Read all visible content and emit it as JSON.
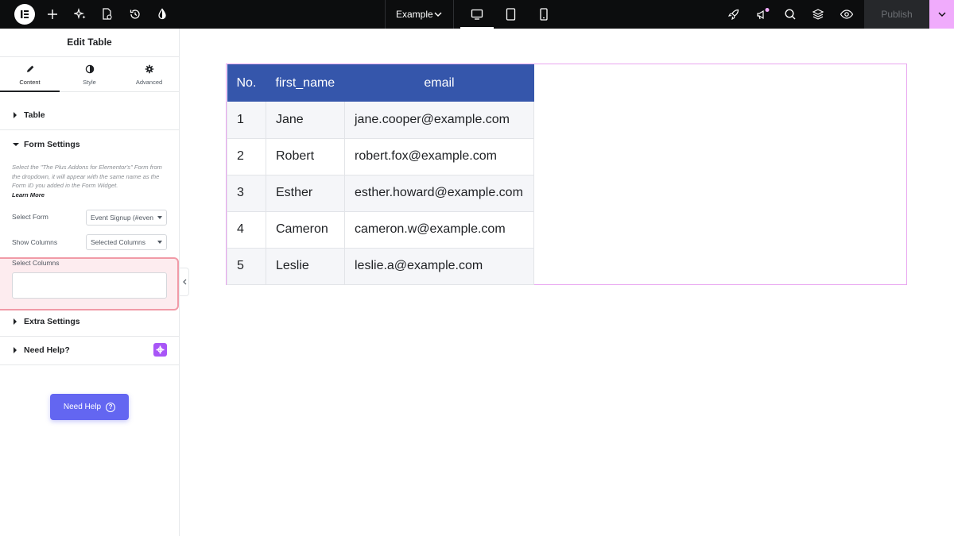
{
  "topbar": {
    "document_name": "Example",
    "publish_label": "Publish",
    "accent_color": "#f0abfc"
  },
  "panel": {
    "title": "Edit Table",
    "tabs": [
      {
        "label": "Content",
        "icon": "pencil-icon",
        "active": true
      },
      {
        "label": "Style",
        "icon": "half-circle-icon",
        "active": false
      },
      {
        "label": "Advanced",
        "icon": "gear-icon",
        "active": false
      }
    ],
    "sections": {
      "table": "Table",
      "form_settings": "Form Settings",
      "extra_settings": "Extra Settings",
      "need_help": "Need Help?"
    },
    "form_description": "Select the \"The Plus Addons for Elementor's\" Form from the dropdown, it will appear with the same name as the Form ID you added in the Form Widget.",
    "learn_more": "Learn More",
    "select_form": {
      "label": "Select Form",
      "value": "Event Signup (#even"
    },
    "show_columns": {
      "label": "Show Columns",
      "value": "Selected Columns"
    },
    "select_columns": {
      "label": "Select Columns",
      "value": ""
    },
    "need_help_button": "Need Help"
  },
  "table": {
    "headers": [
      "No.",
      "first_name",
      "email"
    ],
    "rows": [
      [
        "1",
        "Jane",
        "jane.cooper@example.com"
      ],
      [
        "2",
        "Robert",
        "robert.fox@example.com"
      ],
      [
        "3",
        "Esther",
        "esther.howard@example.com"
      ],
      [
        "4",
        "Cameron",
        "cameron.w@example.com"
      ],
      [
        "5",
        "Leslie",
        "leslie.a@example.com"
      ]
    ],
    "header_color": "#3556ab"
  }
}
